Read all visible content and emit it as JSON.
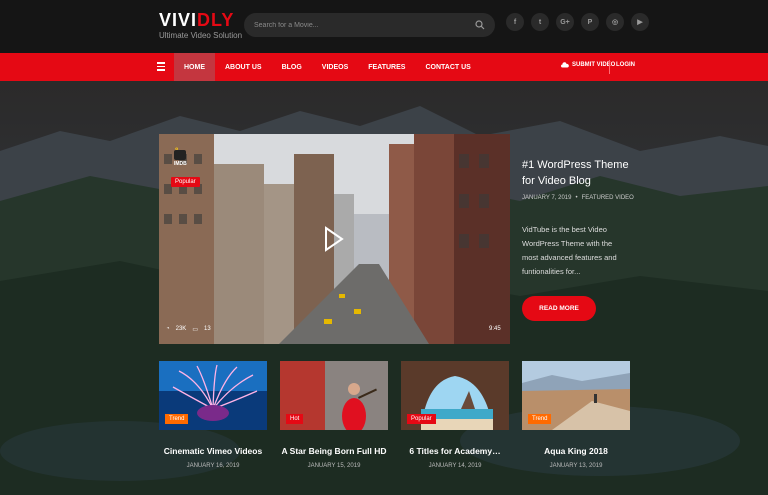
{
  "brand": {
    "logo_part1": "VIVI",
    "logo_part2": "DLY",
    "tagline": "Ultimate Video Solution"
  },
  "search": {
    "placeholder": "Search for a Movie..."
  },
  "social": [
    {
      "icon": "facebook-icon",
      "glyph": "f"
    },
    {
      "icon": "twitter-icon",
      "glyph": "t"
    },
    {
      "icon": "google-plus-icon",
      "glyph": "G+"
    },
    {
      "icon": "pinterest-icon",
      "glyph": "P"
    },
    {
      "icon": "instagram-icon",
      "glyph": "◎"
    },
    {
      "icon": "youtube-icon",
      "glyph": "▶"
    }
  ],
  "nav": {
    "items": [
      "HOME",
      "ABOUT US",
      "BLOG",
      "VIDEOS",
      "FEATURES",
      "CONTACT US"
    ],
    "active": "HOME",
    "submit": "SUBMIT VIDEO",
    "login": "LOGIN"
  },
  "hero": {
    "badge": "Popular",
    "imdb": "IMDB",
    "rating": "8",
    "views": "23K",
    "comments": "13",
    "duration": "9:45",
    "title": "#1 WordPress Theme for Video Blog",
    "date": "JANUARY 7, 2019",
    "category": "FEATURED VIDEO",
    "description": "VidTube is the best Video WordPress Theme with the most advanced features and funtionalities for...",
    "button": "READ MORE"
  },
  "thumbs": [
    {
      "tag": "Trend",
      "title": "Cinematic Vimeo Videos",
      "date": "JANUARY 16, 2019"
    },
    {
      "tag": "Hot",
      "title": "A Star Being Born Full HD",
      "date": "JANUARY 15, 2019"
    },
    {
      "tag": "Popular",
      "title": "6 Titles for Academy…",
      "date": "JANUARY 14, 2019"
    },
    {
      "tag": "Trend",
      "title": "Aqua King 2018",
      "date": "JANUARY 13, 2019"
    }
  ],
  "colors": {
    "accent": "#e50914",
    "header": "#151515",
    "trend": "#ff6a00"
  }
}
